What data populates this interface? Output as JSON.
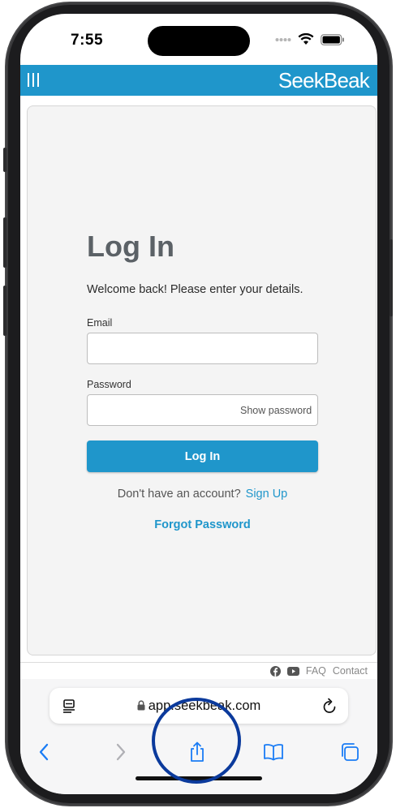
{
  "status_bar": {
    "time": "7:55"
  },
  "header": {
    "logo": "SeekBeak",
    "menu_icon": "menu-bars-icon"
  },
  "login": {
    "title": "Log In",
    "welcome": "Welcome back! Please enter your details.",
    "email_label": "Email",
    "email_value": "",
    "password_label": "Password",
    "password_value": "",
    "show_password": "Show password",
    "button_label": "Log In",
    "no_account_text": "Don't have an account?",
    "signup_link": "Sign Up",
    "forgot_link": "Forgot Password"
  },
  "footer": {
    "faq": "FAQ",
    "contact": "Contact"
  },
  "safari": {
    "url": "app.seekbeak.com",
    "toolbar_icons": [
      "back-icon",
      "forward-icon",
      "share-icon",
      "bookmarks-icon",
      "tabs-icon"
    ]
  },
  "colors": {
    "brand": "#1f96cb",
    "title_gray": "#5b6166",
    "highlight": "#0b3a9c"
  }
}
